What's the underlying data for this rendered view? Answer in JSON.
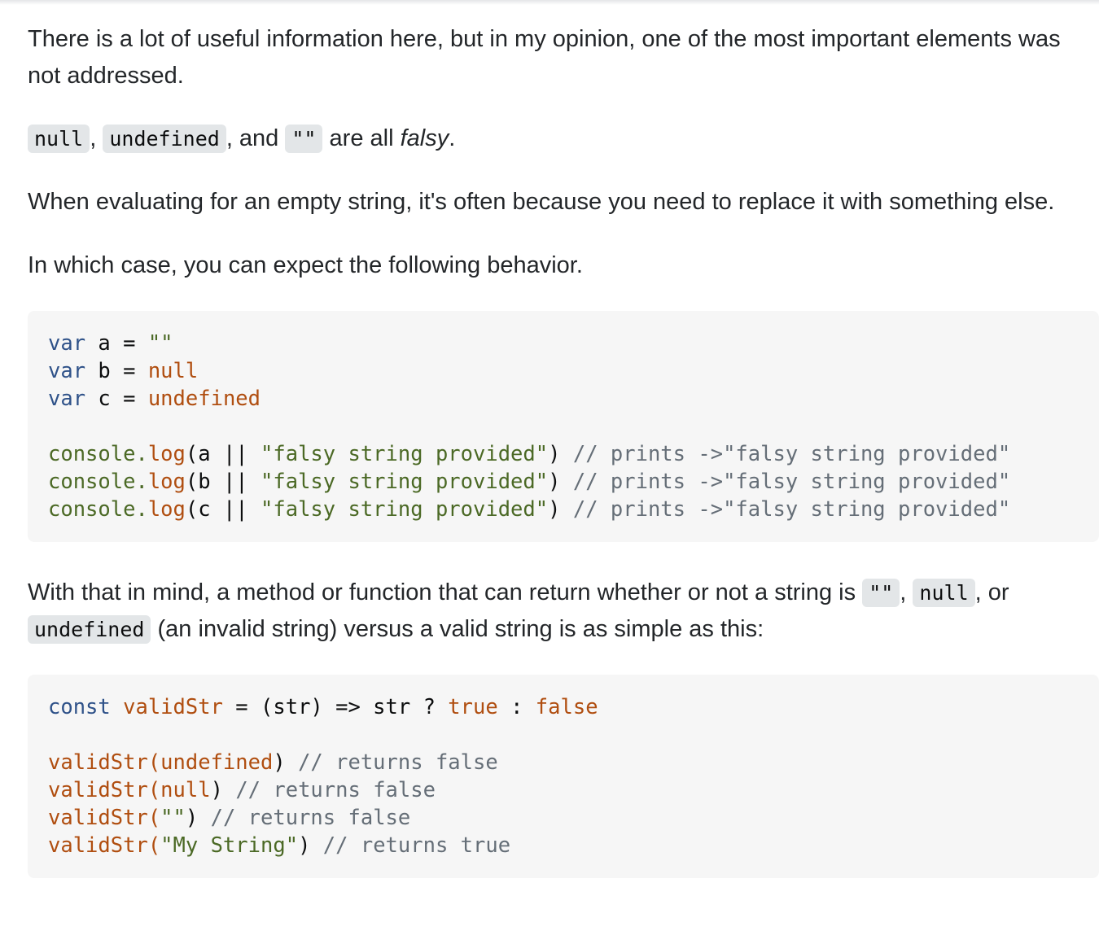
{
  "p1": "There is a lot of useful information here, but in my opinion, one of the most important elements was not addressed.",
  "p2": {
    "code_null": "null",
    "comma1": ", ",
    "code_undefined": "undefined",
    "and_text": ", and ",
    "code_empty": "\"\"",
    "are_all": " are all ",
    "falsy": "falsy",
    "period": "."
  },
  "p3": "When evaluating for an empty string, it's often because you need to replace it with something else.",
  "p4": "In which case, you can expect the following behavior.",
  "code1": {
    "lines": [
      [
        "var",
        " a = ",
        "\"\""
      ],
      [
        "var",
        " b = ",
        "null"
      ],
      [
        "var",
        " c = ",
        "undefined"
      ]
    ],
    "log_lines": [
      [
        "console.",
        "log",
        "(a || ",
        "\"falsy string provided\"",
        ") ",
        "// prints ->\"falsy string provided\""
      ],
      [
        "console.",
        "log",
        "(b || ",
        "\"falsy string provided\"",
        ") ",
        "// prints ->\"falsy string provided\""
      ],
      [
        "console.",
        "log",
        "(c || ",
        "\"falsy string provided\"",
        ") ",
        "// prints ->\"falsy string provided\""
      ]
    ]
  },
  "p5": {
    "text_a": "With that in mind, a method or function that can return whether or not a string is ",
    "code_empty": "\"\"",
    "comma": ", ",
    "code_null": "null",
    "or_text": ", or ",
    "code_undefined": "undefined",
    "text_b": " (an invalid string) versus a valid string is as simple as this:"
  },
  "code2": {
    "decl": [
      "const",
      " ",
      "validStr",
      " = (str) => str ? ",
      "true",
      " : ",
      "false"
    ],
    "calls": [
      [
        "validStr(",
        "undefined",
        ") ",
        "// returns false"
      ],
      [
        "validStr(",
        "null",
        ") ",
        "// returns false"
      ],
      [
        "validStr(",
        "\"\"",
        ") ",
        "// returns false"
      ],
      [
        "validStr(",
        "\"My String\"",
        ") ",
        "// returns true"
      ]
    ]
  }
}
